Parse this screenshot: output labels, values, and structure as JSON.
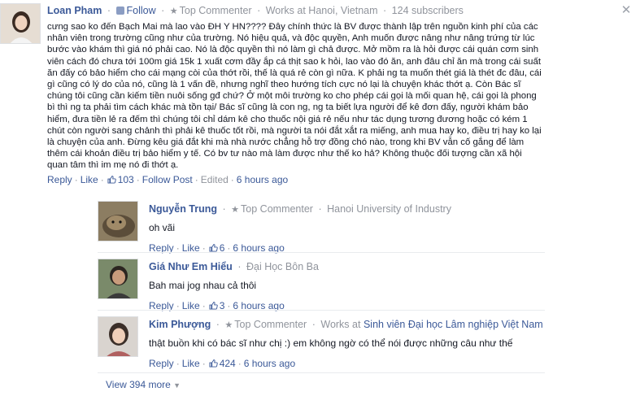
{
  "main": {
    "name": "Loan Pham",
    "follow_label": "Follow",
    "badge": "Top Commenter",
    "work": "Works at Hanoi, Vietnam",
    "subscribers": "124 subscribers",
    "text": "cưng sao ko đến Bạch Mai mà lao vào ĐH Y HN???? Đây chính thức là BV được thành lập trên nguồn kinh phí của các nhân viên trong trường cũng như của trường. Nó hiệu quả, và độc quyền, Anh muốn được nâng như nâng trứng từ lúc bước vào khám thì giá nó phải cao. Nó là độc quyền thì nó làm gì chả được. Mở mồm ra là hỏi được cái quán cơm sinh viên cách đó chưa tới 100m giá 15k 1 xuất cơm đầy ắp cá thịt sao k hỏi, lao vào đó ăn, anh đâu chỉ ăn mà trong cái suất ăn đấy có bảo hiểm cho cái mạng còi của thớt rồi, thế là quá rẻ còn gì nữa. K phải ng ta muốn thét giá là thét đc đâu, cái gì cũng có lý do của nó, cũng là 1 vấn đề, nhưng nghĩ theo hướng tích cực nó lại là chuyện khác thớt ạ. Còn Bác sĩ chúng tôi cũng cần kiếm tiền nuôi sống gđ chứ? Ở một môi trường ko cho phép cái gọi là mối quan hệ, cái gọi là phong bì thì ng ta phải tìm cách khác mà tồn tại/ Bác sĩ cũng là con ng, ng ta biết lựa người để kê đơn đấy, người khám bảo hiểm, đưa tiền lẻ ra đếm thì chúng tôi chỉ dám kê cho thuốc nội giá rẻ nếu như tác dụng tương đương hoặc có kém 1 chút còn người sang chảnh thì phải kê thuốc tốt rồi, mà người ta nói đắt xắt ra miếng, anh mua hay ko, điều trị hay ko lại là chuyện của anh. Đừng kêu giá đắt khi mà nhà nước chẳng hỗ trợ đồng chó nào, trong khi BV vẫn cố gắng để làm thêm cái khoản điều trị bảo hiểm y tế. Có bv tư nào mà làm được như thế ko hả? Không thuộc đối tượng cần xã hội quan tâm thì im mẹ nó đi thớt ạ.",
    "reply_label": "Reply",
    "like_label": "Like",
    "like_count": "103",
    "follow_post_label": "Follow Post",
    "edited_label": "Edited",
    "time": "6 hours ago"
  },
  "replies": [
    {
      "name": "Nguyễn Trung",
      "badge": "Top Commenter",
      "meta": "Hanoi University of Industry",
      "text": "oh vãi",
      "reply_label": "Reply",
      "like_label": "Like",
      "like_count": "6",
      "time": "6 hours ago"
    },
    {
      "name": "Giá Như Em Hiểu",
      "meta": "Đại Học Bôn Ba",
      "text": "Bah mai jog nhau cả thôi",
      "reply_label": "Reply",
      "like_label": "Like",
      "like_count": "3",
      "time": "6 hours ago"
    },
    {
      "name": "Kim Phượng",
      "badge": "Top Commenter",
      "work_prefix": "Works at",
      "work_place": "Sinh viên Đại học Lâm nghiệp Việt Nam",
      "text": "thật buồn khi có bác sĩ như chị :) em không ngờ có thể nói được những câu như thế",
      "reply_label": "Reply",
      "like_label": "Like",
      "like_count": "424",
      "time": "6 hours ago"
    }
  ],
  "view_more": "View 394 more",
  "colors": {
    "link": "#3b5998",
    "meta": "#90949c",
    "text": "#141823"
  }
}
